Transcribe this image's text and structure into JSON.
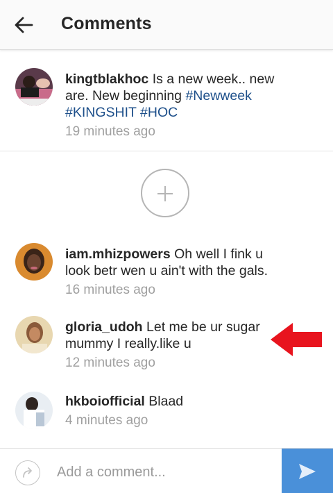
{
  "header": {
    "title": "Comments",
    "back_icon": "arrow-left-icon"
  },
  "caption": {
    "username": "kingtblakhoc",
    "text": "Is a new week.. new are. New beginning",
    "hashtags": [
      "#Newweek",
      "#KINGSHIT",
      "#HOC"
    ],
    "time": "19 minutes ago"
  },
  "load_more_icon": "plus-circle-icon",
  "comments": [
    {
      "username": "iam.mhizpowers",
      "text": "Oh well I fink u look betr wen u ain't with the gals.",
      "time": "16 minutes ago"
    },
    {
      "username": "gloria_udoh",
      "text": "Let me be ur sugar mummy I really.like u",
      "time": "12 minutes ago"
    },
    {
      "username": "hkboiofficial",
      "text": "Blaad",
      "time": "4 minutes ago"
    }
  ],
  "annotation": {
    "arrow_color": "#e8141e"
  },
  "footer": {
    "placeholder": "Add a comment...",
    "share_icon": "share-arrow-icon",
    "send_icon": "send-icon"
  },
  "colors": {
    "hashtag": "#1d4f8a",
    "send_button": "#4a90d9",
    "timestamp": "#a0a0a0"
  }
}
